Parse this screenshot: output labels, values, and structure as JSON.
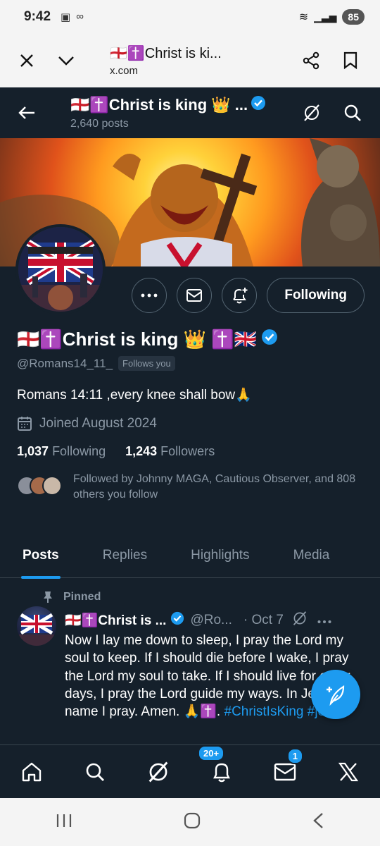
{
  "statusbar": {
    "time": "9:42",
    "battery": "85"
  },
  "browser": {
    "page_title": "🏴󠁧󠁢󠁥󠁮󠁧󠁿✝️Christ is ki...",
    "url": "x.com"
  },
  "header": {
    "title": "🏴󠁧󠁢󠁥󠁮󠁧󠁿✝️Christ is king 👑 ...",
    "posts_count": "2,640 posts"
  },
  "actions": {
    "follow_label": "Following"
  },
  "profile": {
    "name": "🏴󠁧󠁢󠁥󠁮󠁧󠁿✝️Christ is king 👑 ✝️🇬🇧",
    "handle": "@Romans14_11_",
    "follows_you": "Follows you",
    "bio": "Romans 14:11 ,every knee shall bow🙏",
    "joined": "Joined August 2024",
    "following_count": "1,037",
    "following_label": "Following",
    "followers_count": "1,243",
    "followers_label": "Followers",
    "followed_by": "Followed by Johnny MAGA, Cautious Observer, and 808 others you follow"
  },
  "tabs": [
    {
      "label": "Posts"
    },
    {
      "label": "Replies"
    },
    {
      "label": "Highlights"
    },
    {
      "label": "Media"
    }
  ],
  "tweet": {
    "pinned_label": "Pinned",
    "name": "🏴󠁧󠁢󠁥󠁮󠁧󠁿✝️Christ is ...",
    "handle": "@Ro...",
    "date": "· Oct 7",
    "text": "Now I lay me down to sleep, I pray the Lord my soul to keep. If I should die before I wake, I pray the Lord my soul to take. If I should live for other days, I pray the Lord guide my ways. In Jesus' name  I pray. Amen. 🙏✝️. ",
    "hashtags": "#ChristIsKing  #jesus"
  },
  "bottomnav": {
    "notifications_badge": "20+",
    "messages_badge": "1"
  },
  "colors": {
    "background": "#15202b",
    "accent": "#1d9bf0",
    "muted": "#8b98a5"
  }
}
